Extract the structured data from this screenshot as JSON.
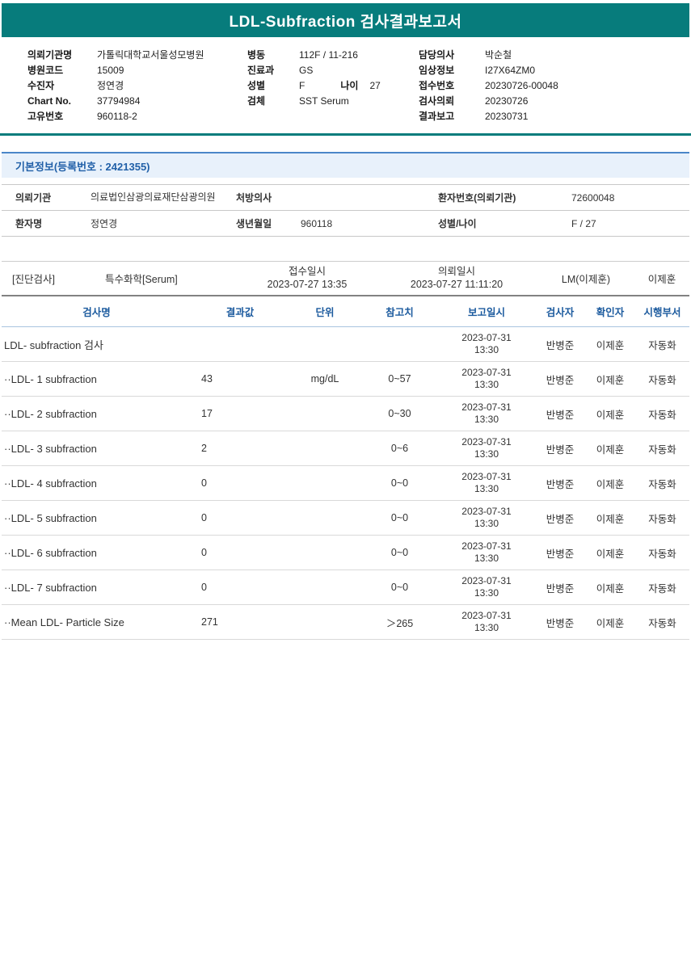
{
  "title": "LDL-Subfraction 검사결과보고서",
  "colors": {
    "banner_teal": "#077c7c",
    "section_title_blue": "#2160a8",
    "table_header_blue": "#1b5a9e",
    "section_header_bg": "#e8f1fb"
  },
  "header": {
    "left": {
      "org_label": "의뢰기관명",
      "org_value": "가톨릭대학교서울성모병원",
      "hospital_code_label": "병원코드",
      "hospital_code_value": "15009",
      "examinee_label": "수진자",
      "examinee_value": "정연경",
      "chart_no_label": "Chart No.",
      "chart_no_value": "37794984",
      "unique_no_label": "고유번호",
      "unique_no_value": "960118-2"
    },
    "middle": {
      "ward_label": "병동",
      "ward_value": "112F / 11-216",
      "dept_label": "진료과",
      "dept_value": "GS",
      "sex_label": "성별",
      "sex_value": "F",
      "age_label": "나이",
      "age_value": "27",
      "specimen_label": "검체",
      "specimen_value": "SST Serum"
    },
    "right": {
      "doctor_label": "담당의사",
      "doctor_value": "박순철",
      "clinical_label": "임상정보",
      "clinical_value": "I27X64ZM0",
      "receipt_no_label": "접수번호",
      "receipt_no_value": "20230726-00048",
      "order_date_label": "검사의뢰",
      "order_date_value": "20230726",
      "report_date_label": "결과보고",
      "report_date_value": "20230731"
    }
  },
  "basic_info": {
    "section_title": "기본정보(등록번호 : 2421355)",
    "request_org_label": "의뢰기관",
    "request_org_value": "의료법인삼광의료재단삼광의원",
    "prescriber_label": "처방의사",
    "prescriber_value": "",
    "patient_no_label": "환자번호(의뢰기관)",
    "patient_no_value": "72600048",
    "patient_name_label": "환자명",
    "patient_name_value": "정연경",
    "birth_label": "생년월일",
    "birth_value": "960118",
    "sex_age_label": "성별/나이",
    "sex_age_value": "F / 27"
  },
  "exam": {
    "category": "[진단검사]",
    "test_group": "특수화학[Serum]",
    "receipt_label": "접수일시",
    "receipt_datetime": "2023-07-27 13:35",
    "request_label": "의뢰일시",
    "request_datetime": "2023-07-27 11:11:20",
    "lab_reader": "LM(이제훈)",
    "confirmer": "이제훈"
  },
  "results": {
    "columns": [
      "검사명",
      "결과값",
      "단위",
      "참고치",
      "보고일시",
      "검사자",
      "확인자",
      "시행부서"
    ],
    "rows": [
      {
        "name": "LDL- subfraction 검사",
        "value": "",
        "unit": "",
        "range": "",
        "report_date": "2023-07-31",
        "report_time": "13:30",
        "tester": "반병준",
        "verifier": "이제훈",
        "dept": "자동화"
      },
      {
        "name": "··LDL- 1 subfraction",
        "value": "43",
        "unit": "mg/dL",
        "range": "0~57",
        "report_date": "2023-07-31",
        "report_time": "13:30",
        "tester": "반병준",
        "verifier": "이제훈",
        "dept": "자동화"
      },
      {
        "name": "··LDL- 2 subfraction",
        "value": "17",
        "unit": "",
        "range": "0~30",
        "report_date": "2023-07-31",
        "report_time": "13:30",
        "tester": "반병준",
        "verifier": "이제훈",
        "dept": "자동화"
      },
      {
        "name": "··LDL- 3 subfraction",
        "value": "2",
        "unit": "",
        "range": "0~6",
        "report_date": "2023-07-31",
        "report_time": "13:30",
        "tester": "반병준",
        "verifier": "이제훈",
        "dept": "자동화"
      },
      {
        "name": "··LDL- 4 subfraction",
        "value": "0",
        "unit": "",
        "range": "0~0",
        "report_date": "2023-07-31",
        "report_time": "13:30",
        "tester": "반병준",
        "verifier": "이제훈",
        "dept": "자동화"
      },
      {
        "name": "··LDL- 5 subfraction",
        "value": "0",
        "unit": "",
        "range": "0~0",
        "report_date": "2023-07-31",
        "report_time": "13:30",
        "tester": "반병준",
        "verifier": "이제훈",
        "dept": "자동화"
      },
      {
        "name": "··LDL- 6 subfraction",
        "value": "0",
        "unit": "",
        "range": "0~0",
        "report_date": "2023-07-31",
        "report_time": "13:30",
        "tester": "반병준",
        "verifier": "이제훈",
        "dept": "자동화"
      },
      {
        "name": "··LDL- 7 subfraction",
        "value": "0",
        "unit": "",
        "range": "0~0",
        "report_date": "2023-07-31",
        "report_time": "13:30",
        "tester": "반병준",
        "verifier": "이제훈",
        "dept": "자동화"
      },
      {
        "name": "··Mean LDL- Particle Size",
        "value": "271",
        "unit": "",
        "range": "＞265",
        "report_date": "2023-07-31",
        "report_time": "13:30",
        "tester": "반병준",
        "verifier": "이제훈",
        "dept": "자동화"
      }
    ]
  }
}
